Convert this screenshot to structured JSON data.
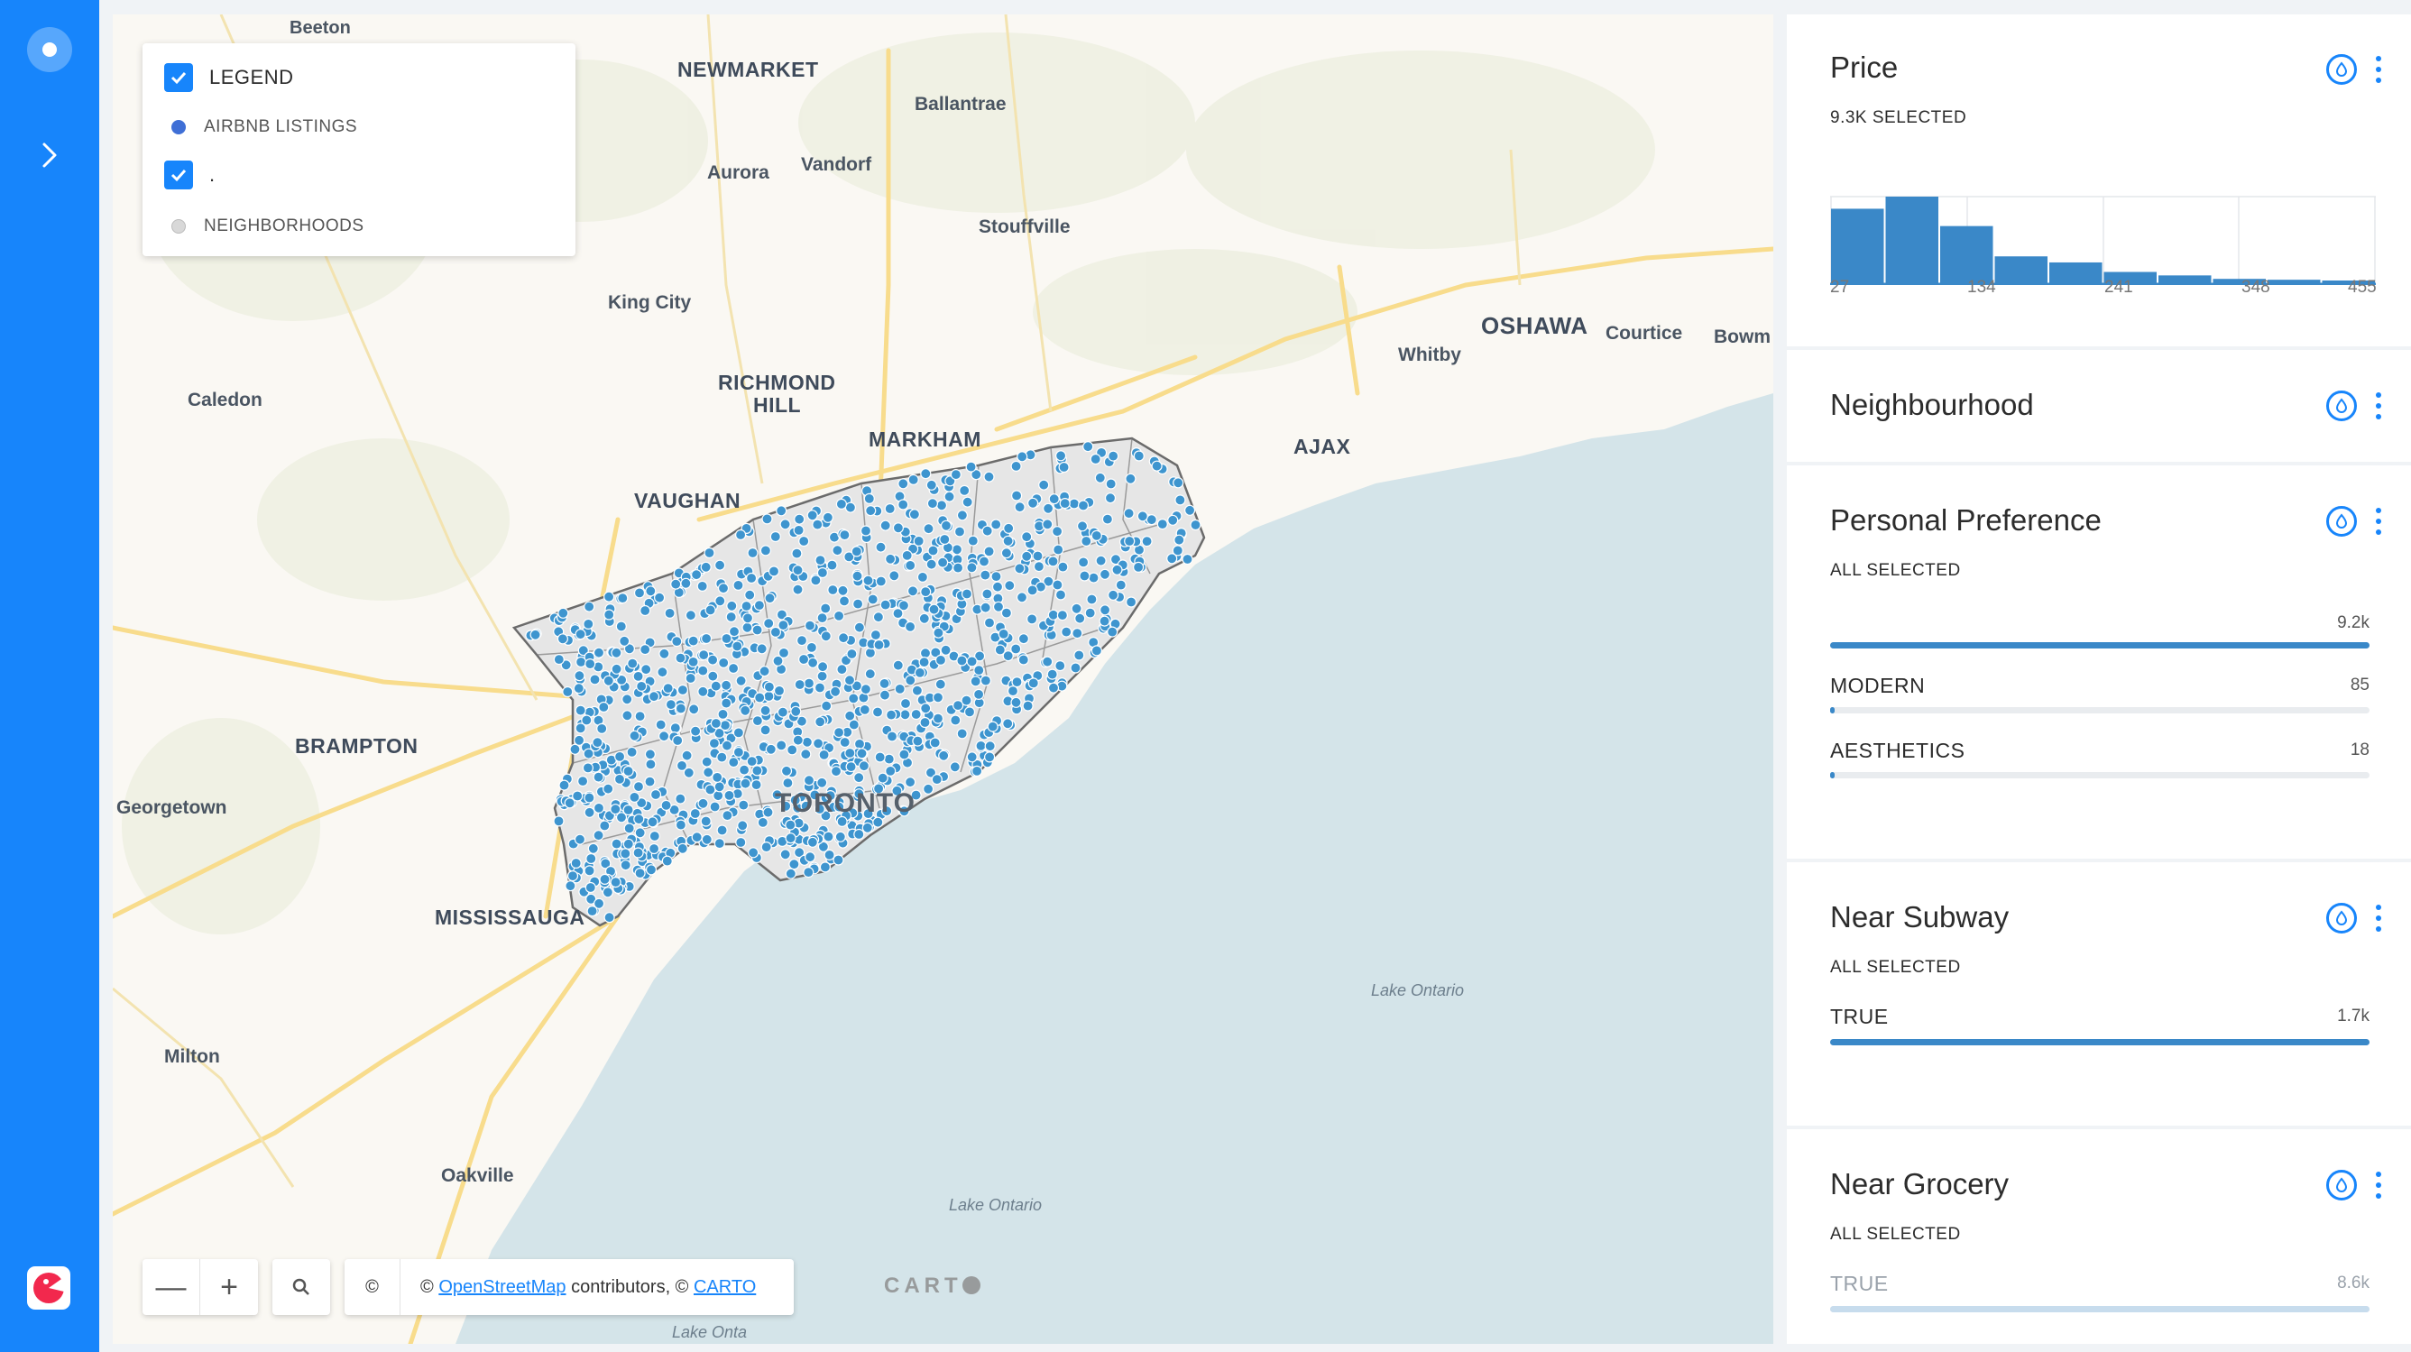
{
  "map": {
    "labels": {
      "beeton": "Beeton",
      "newmarket": "NEWMARKET",
      "ballantrae": "Ballantrae",
      "aurora": "Aurora",
      "vandorf": "Vandorf",
      "stouffville": "Stouffville",
      "king_city": "King City",
      "richmond_hill": "RICHMOND",
      "richmond_hill_2": "HILL",
      "caledon": "Caledon",
      "markham": "MARKHAM",
      "vaughan": "VAUGHAN",
      "oshawa": "OSHAWA",
      "courtice": "Courtice",
      "bowm": "Bowm",
      "whitby": "Whitby",
      "ajax": "AJAX",
      "brampton": "BRAMPTON",
      "georgetown": "Georgetown",
      "toronto": "TORONTO",
      "mississauga": "MISSISSAUGA",
      "milton": "Milton",
      "oakville": "Oakville",
      "lake_ontario_1": "Lake Ontario",
      "lake_ontario_2": "Lake Ontario",
      "lake_ontario_3": "Lake Onta"
    },
    "listing_color": "#3e95cf",
    "water_color": "#d4e4e9"
  },
  "legend": {
    "title": "LEGEND",
    "layers": [
      {
        "name": "AIRBNB LISTINGS",
        "color": "#3f6fd6"
      },
      {
        "name": ".",
        "checked": true
      },
      {
        "name": "NEIGHBORHOODS",
        "color": "#d8d8d8"
      }
    ]
  },
  "controls": {
    "zoom_out": "—",
    "zoom_in": "+",
    "copyright_symbol": "©",
    "attribution_prefix": "©",
    "osm_link": "OpenStreetMap",
    "attribution_mid": "contributors, ©",
    "carto_link": "CARTO",
    "watermark": "CART"
  },
  "widgets": {
    "price": {
      "title": "Price",
      "subtitle": "9.3K SELECTED",
      "axis": [
        "27",
        "134",
        "241",
        "348",
        "455"
      ],
      "bins": [
        0.86,
        1.0,
        0.66,
        0.31,
        0.24,
        0.13,
        0.09,
        0.05,
        0.04,
        0.03
      ]
    },
    "neighbourhood": {
      "title": "Neighbourhood"
    },
    "personal_preference": {
      "title": "Personal Preference",
      "subtitle": "ALL SELECTED",
      "total": "9.2k",
      "rows": [
        {
          "label": "MODERN",
          "value": "85",
          "fraction": 0.009
        },
        {
          "label": "AESTHETICS",
          "value": "18",
          "fraction": 0.002
        }
      ]
    },
    "near_subway": {
      "title": "Near Subway",
      "subtitle": "ALL SELECTED",
      "rows": [
        {
          "label": "TRUE",
          "value": "1.7k",
          "fraction": 1.0
        }
      ]
    },
    "near_grocery": {
      "title": "Near Grocery",
      "subtitle": "ALL SELECTED",
      "rows": [
        {
          "label": "TRUE",
          "value": "8.6k",
          "fraction": 1.0
        }
      ]
    }
  },
  "accent_color": "#1785fb"
}
